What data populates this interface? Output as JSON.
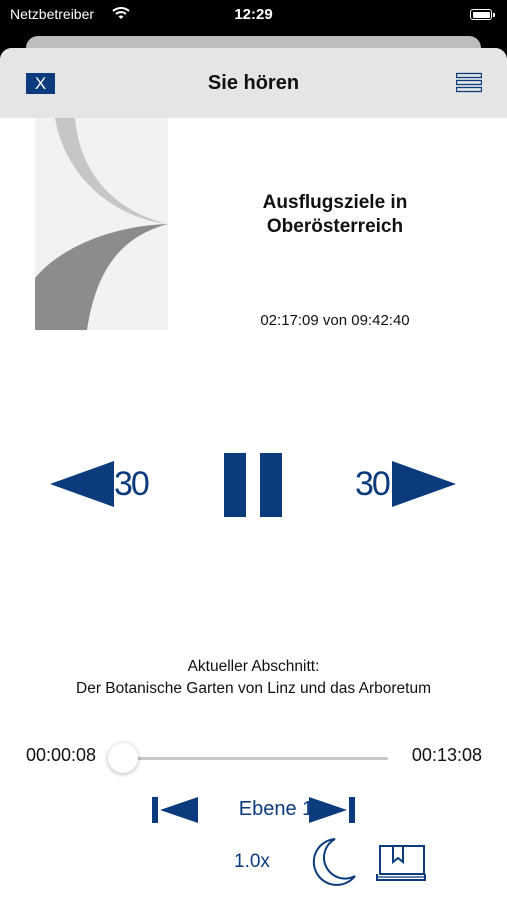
{
  "status_bar": {
    "carrier": "Netzbetreiber",
    "time": "12:29"
  },
  "nav": {
    "close_label": "X",
    "title": "Sie hören"
  },
  "book": {
    "title": "Ausflugsziele in Oberösterreich",
    "position_text": "02:17:09 von 09:42:40"
  },
  "controls": {
    "rewind_label": "30",
    "forward_label": "30"
  },
  "section": {
    "caption": "Aktueller Abschnitt:",
    "name": "Der Botanische Garten von Linz und das Arboretum"
  },
  "progress": {
    "elapsed": "00:00:08",
    "total": "00:13:08",
    "fraction": 0.01
  },
  "navigation_level": {
    "label": "Ebene 1"
  },
  "bottom": {
    "speed_label": "1.0x"
  },
  "colors": {
    "accent": "#0b3b7c",
    "nav_background": "#e5e5e5"
  },
  "icons": {
    "wifi": "wifi-icon",
    "battery": "battery-icon",
    "menu": "hamburger-menu-icon",
    "rewind": "rewind-arrow-icon",
    "pause": "pause-icon",
    "forward": "forward-arrow-icon",
    "prev_level": "skip-previous-icon",
    "next_level": "skip-next-icon",
    "sleep": "moon-icon",
    "bookmark": "bookmark-book-icon"
  }
}
